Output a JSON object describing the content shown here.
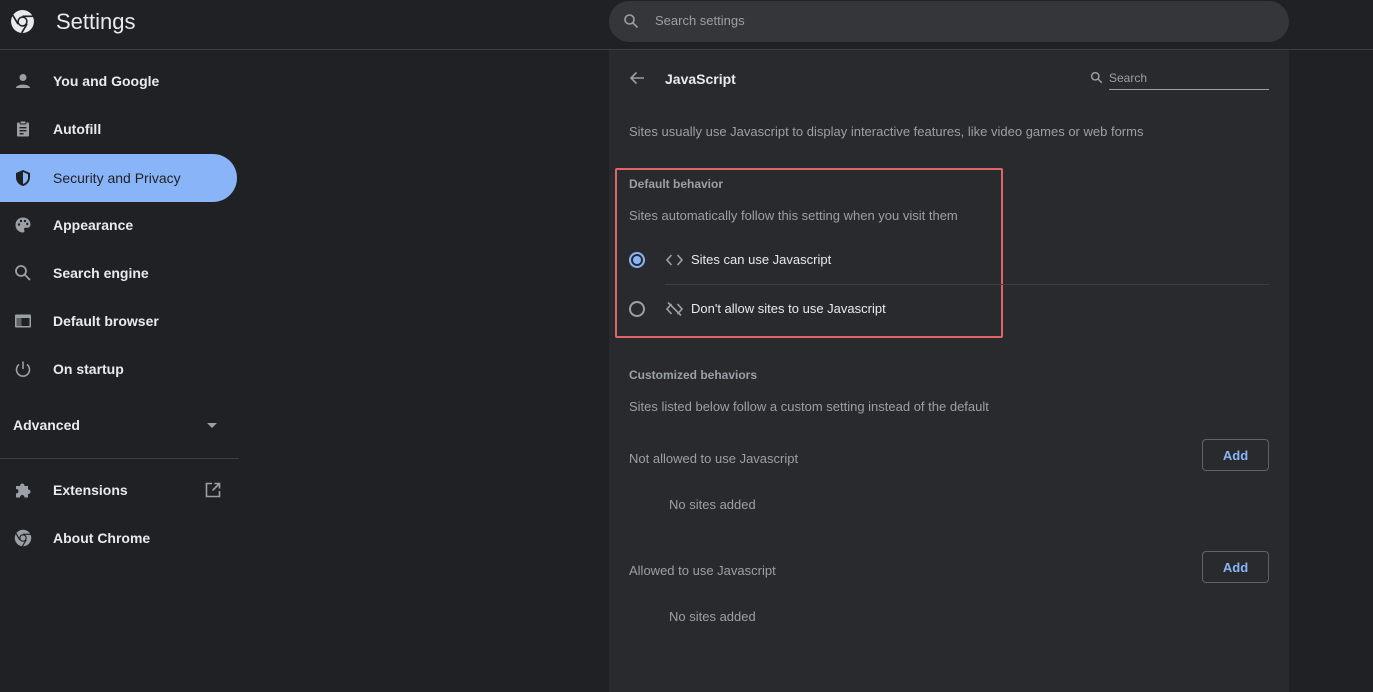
{
  "app": {
    "title": "Settings"
  },
  "search": {
    "placeholder": "Search settings"
  },
  "sidebar": {
    "items": [
      {
        "label": "You and Google",
        "icon": "person-icon"
      },
      {
        "label": "Autofill",
        "icon": "clipboard-icon"
      },
      {
        "label": "Security and Privacy",
        "icon": "shield-icon",
        "active": true
      },
      {
        "label": "Appearance",
        "icon": "palette-icon"
      },
      {
        "label": "Search engine",
        "icon": "search-icon"
      },
      {
        "label": "Default browser",
        "icon": "browser-window-icon"
      },
      {
        "label": "On startup",
        "icon": "power-icon"
      }
    ],
    "advanced_label": "Advanced",
    "extensions_label": "Extensions",
    "about_label": "About Chrome"
  },
  "page": {
    "title": "JavaScript",
    "search_placeholder": "Search",
    "description": "Sites usually use Javascript to display interactive features, like video games or web forms",
    "default_behavior": {
      "heading": "Default behavior",
      "subtitle": "Sites automatically follow this setting when you visit them",
      "options": [
        {
          "label": "Sites can use Javascript",
          "icon": "code-brackets-icon",
          "selected": true
        },
        {
          "label": "Don't allow sites to use Javascript",
          "icon": "code-off-icon",
          "selected": false
        }
      ]
    },
    "customized": {
      "heading": "Customized behaviors",
      "subtitle": "Sites listed below follow a custom setting instead of the default",
      "lists": [
        {
          "label": "Not allowed to use Javascript",
          "add_label": "Add",
          "empty": "No sites added"
        },
        {
          "label": "Allowed to use Javascript",
          "add_label": "Add",
          "empty": "No sites added"
        }
      ]
    }
  },
  "colors": {
    "background": "#202124",
    "card": "#292a2d",
    "accent": "#8ab4f8",
    "highlight_border": "#e06666"
  }
}
